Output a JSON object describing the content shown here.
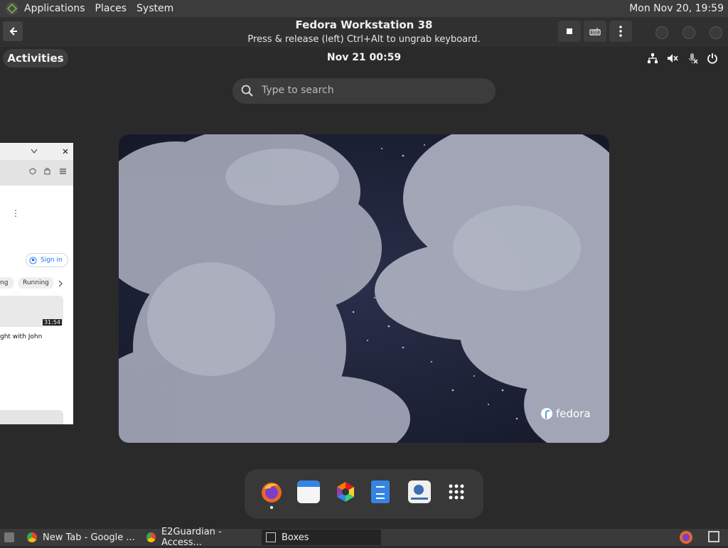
{
  "host_panel": {
    "menus": [
      "Applications",
      "Places",
      "System"
    ],
    "clock": "Mon Nov 20, 19:59"
  },
  "boxes_header": {
    "title": "Fedora Workstation 38",
    "subtitle": "Press & release (left) Ctrl+Alt to ungrab keyboard."
  },
  "guest": {
    "activities_label": "Activities",
    "clock": "Nov 21  00:59",
    "search_placeholder": "Type to search",
    "wallpaper_brand": "fedora",
    "side_window": {
      "sign_in": "Sign in",
      "chip_1": "ng",
      "chip_2": "Running",
      "duration": "31:54",
      "video_title": "ght with John"
    },
    "dash_apps": [
      "firefox-icon",
      "calendar-icon",
      "software-icon",
      "text-editor-icon",
      "boxes-icon",
      "app-grid-icon"
    ]
  },
  "taskbar": {
    "items": [
      {
        "label": "New Tab - Google ...",
        "icon": "chrome-icon"
      },
      {
        "label": "E2Guardian - Access...",
        "icon": "chrome-icon"
      },
      {
        "label": "Boxes",
        "icon": "boxes-icon"
      }
    ]
  }
}
